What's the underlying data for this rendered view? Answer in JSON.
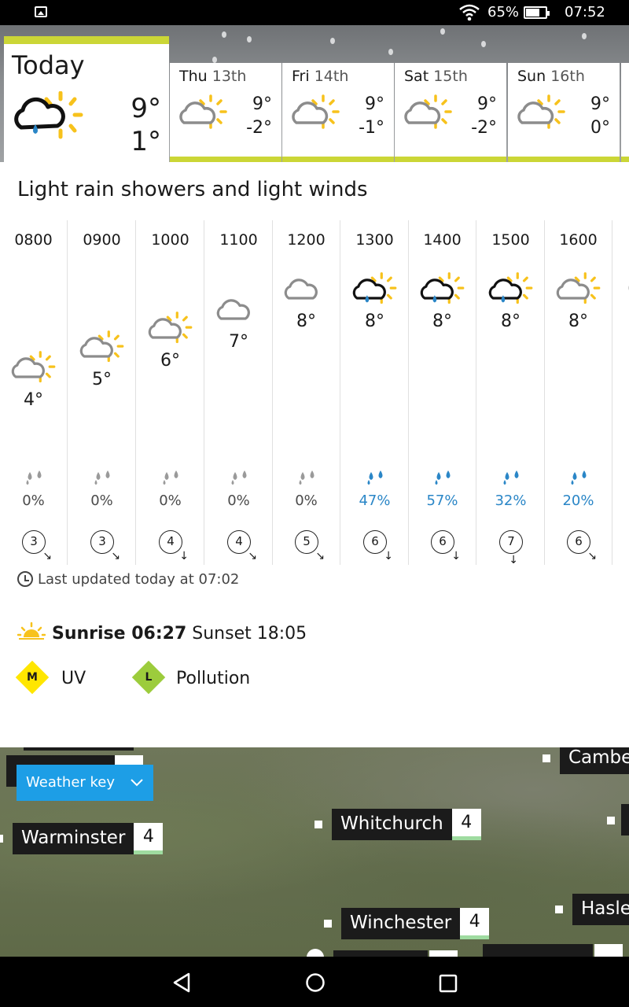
{
  "status_bar": {
    "battery": "65%",
    "time": "07:52"
  },
  "today": {
    "label": "Today",
    "max": "9°",
    "min": "1°",
    "icon": "light-rain-showers-icon"
  },
  "days": [
    {
      "name": "Thu",
      "date": "13th",
      "max": "9°",
      "min": "-2°",
      "icon": "sunny-intervals-icon"
    },
    {
      "name": "Fri",
      "date": "14th",
      "max": "9°",
      "min": "-1°",
      "icon": "sunny-intervals-icon"
    },
    {
      "name": "Sat",
      "date": "15th",
      "max": "9°",
      "min": "-2°",
      "icon": "sunny-intervals-icon"
    },
    {
      "name": "Sun",
      "date": "16th",
      "max": "9°",
      "min": "0°",
      "icon": "sunny-intervals-icon"
    }
  ],
  "summary": "Light rain showers and light winds",
  "hourly": [
    {
      "time": "0800",
      "temp": "4°",
      "rain": "0%",
      "wind": "3",
      "icon": "sunny-intervals-icon"
    },
    {
      "time": "0900",
      "temp": "5°",
      "rain": "0%",
      "wind": "3",
      "icon": "sunny-intervals-icon"
    },
    {
      "time": "1000",
      "temp": "6°",
      "rain": "0%",
      "wind": "4",
      "icon": "sunny-intervals-icon"
    },
    {
      "time": "1100",
      "temp": "7°",
      "rain": "0%",
      "wind": "4",
      "icon": "cloud-icon"
    },
    {
      "time": "1200",
      "temp": "8°",
      "rain": "0%",
      "wind": "5",
      "icon": "cloud-icon"
    },
    {
      "time": "1300",
      "temp": "8°",
      "rain": "47%",
      "wind": "6",
      "icon": "light-rain-showers-icon"
    },
    {
      "time": "1400",
      "temp": "8°",
      "rain": "57%",
      "wind": "6",
      "icon": "light-rain-showers-icon"
    },
    {
      "time": "1500",
      "temp": "8°",
      "rain": "32%",
      "wind": "7",
      "icon": "light-rain-showers-icon"
    },
    {
      "time": "1600",
      "temp": "8°",
      "rain": "20%",
      "wind": "6",
      "icon": "sunny-intervals-icon"
    }
  ],
  "last_updated": "Last updated today at 07:02",
  "sun": {
    "sunrise_label": "Sunrise 06:27",
    "sunset_label": "Sunset 18:05"
  },
  "badges": {
    "uv": {
      "level": "M",
      "label": "UV",
      "color": "#ffe600"
    },
    "pollution": {
      "level": "L",
      "label": "Pollution",
      "color": "#9ccc3c"
    }
  },
  "map": {
    "weather_key_label": "Weather key",
    "places": [
      {
        "name": "Camber",
        "value": ""
      },
      {
        "name": "Whitchurch",
        "value": "4"
      },
      {
        "name": "Warminster",
        "value": "4"
      },
      {
        "name": "Winchester",
        "value": "4"
      },
      {
        "name": "Hasler",
        "value": ""
      }
    ]
  },
  "colors": {
    "accent_bar": "#cbd636",
    "rain_blue": "#2a86c7",
    "key_blue": "#1d9ee6",
    "sun_yellow": "#f7c21c"
  }
}
